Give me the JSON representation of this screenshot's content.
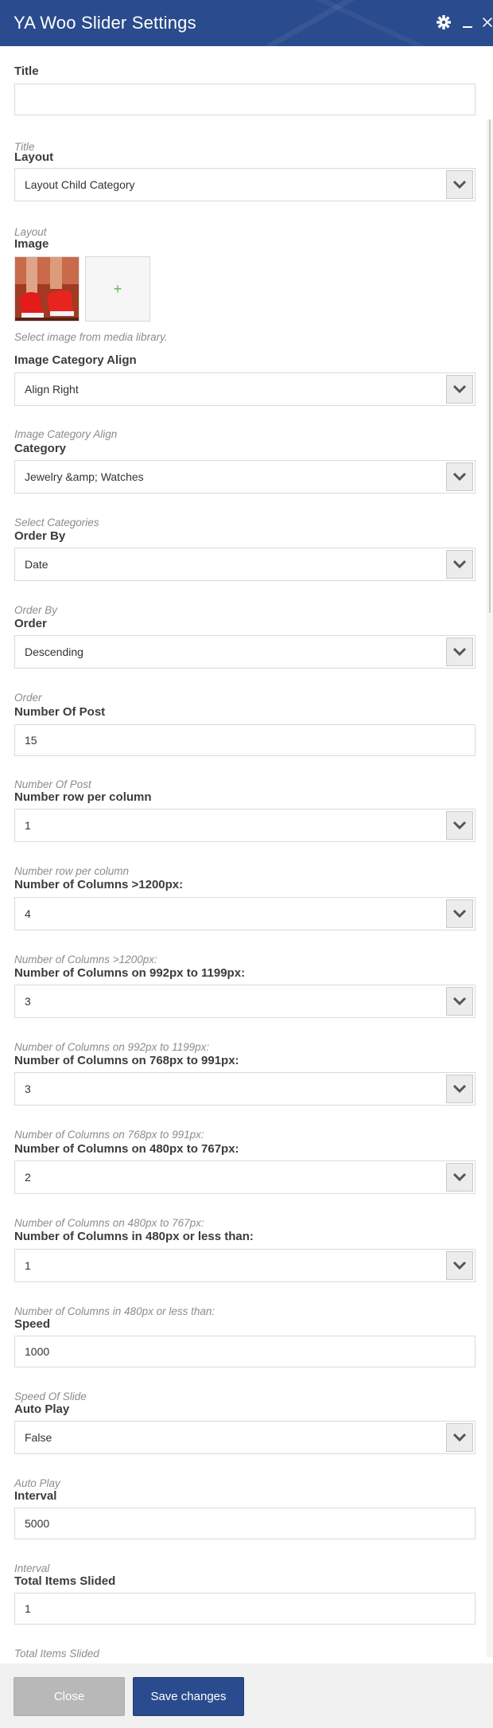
{
  "dialog": {
    "title": "YA Woo Slider Settings",
    "header_color": "#2a4b8d",
    "icons": {
      "settings": "gear-icon",
      "minimize": "minimize-icon",
      "close": "close-icon"
    }
  },
  "form": {
    "title": {
      "label": "Title",
      "value": "",
      "hint": "Title"
    },
    "layout": {
      "label": "Layout",
      "value": "Layout Child Category",
      "hint": "Layout"
    },
    "image": {
      "label": "Image",
      "add_symbol": "+",
      "hint": "Select image from media library."
    },
    "image_align": {
      "label": "Image Category Align",
      "value": "Align Right",
      "hint": "Image Category Align"
    },
    "category": {
      "label": "Category",
      "value": "Jewelry &amp; Watches",
      "hint": "Select Categories"
    },
    "order_by": {
      "label": "Order By",
      "value": "Date",
      "hint": "Order By"
    },
    "order": {
      "label": "Order",
      "value": "Descending",
      "hint": "Order"
    },
    "number_of_post": {
      "label": "Number Of Post",
      "value": "15",
      "hint": "Number Of Post"
    },
    "rows_per_column": {
      "label": "Number row per column",
      "value": "1",
      "hint": "Number row per column"
    },
    "cols_1200": {
      "label": "Number of Columns >1200px:",
      "value": "4",
      "hint": "Number of Columns >1200px:"
    },
    "cols_992": {
      "label": "Number of Columns on 992px to 1199px:",
      "value": "3",
      "hint": "Number of Columns on 992px to 1199px:"
    },
    "cols_768": {
      "label": "Number of Columns on 768px to 991px:",
      "value": "3",
      "hint": "Number of Columns on 768px to 991px:"
    },
    "cols_480": {
      "label": "Number of Columns on 480px to 767px:",
      "value": "2",
      "hint": "Number of Columns on 480px to 767px:"
    },
    "cols_less_480": {
      "label": "Number of Columns in 480px or less than:",
      "value": "1",
      "hint": "Number of Columns in 480px or less than:"
    },
    "speed": {
      "label": "Speed",
      "value": "1000",
      "hint": "Speed Of Slide"
    },
    "auto_play": {
      "label": "Auto Play",
      "value": "False",
      "hint": "Auto Play"
    },
    "interval": {
      "label": "Interval",
      "value": "5000",
      "hint": "Interval"
    },
    "total_items_slided": {
      "label": "Total Items Slided",
      "value": "1",
      "hint": "Total Items Slided"
    }
  },
  "footer": {
    "close_label": "Close",
    "save_label": "Save changes"
  }
}
